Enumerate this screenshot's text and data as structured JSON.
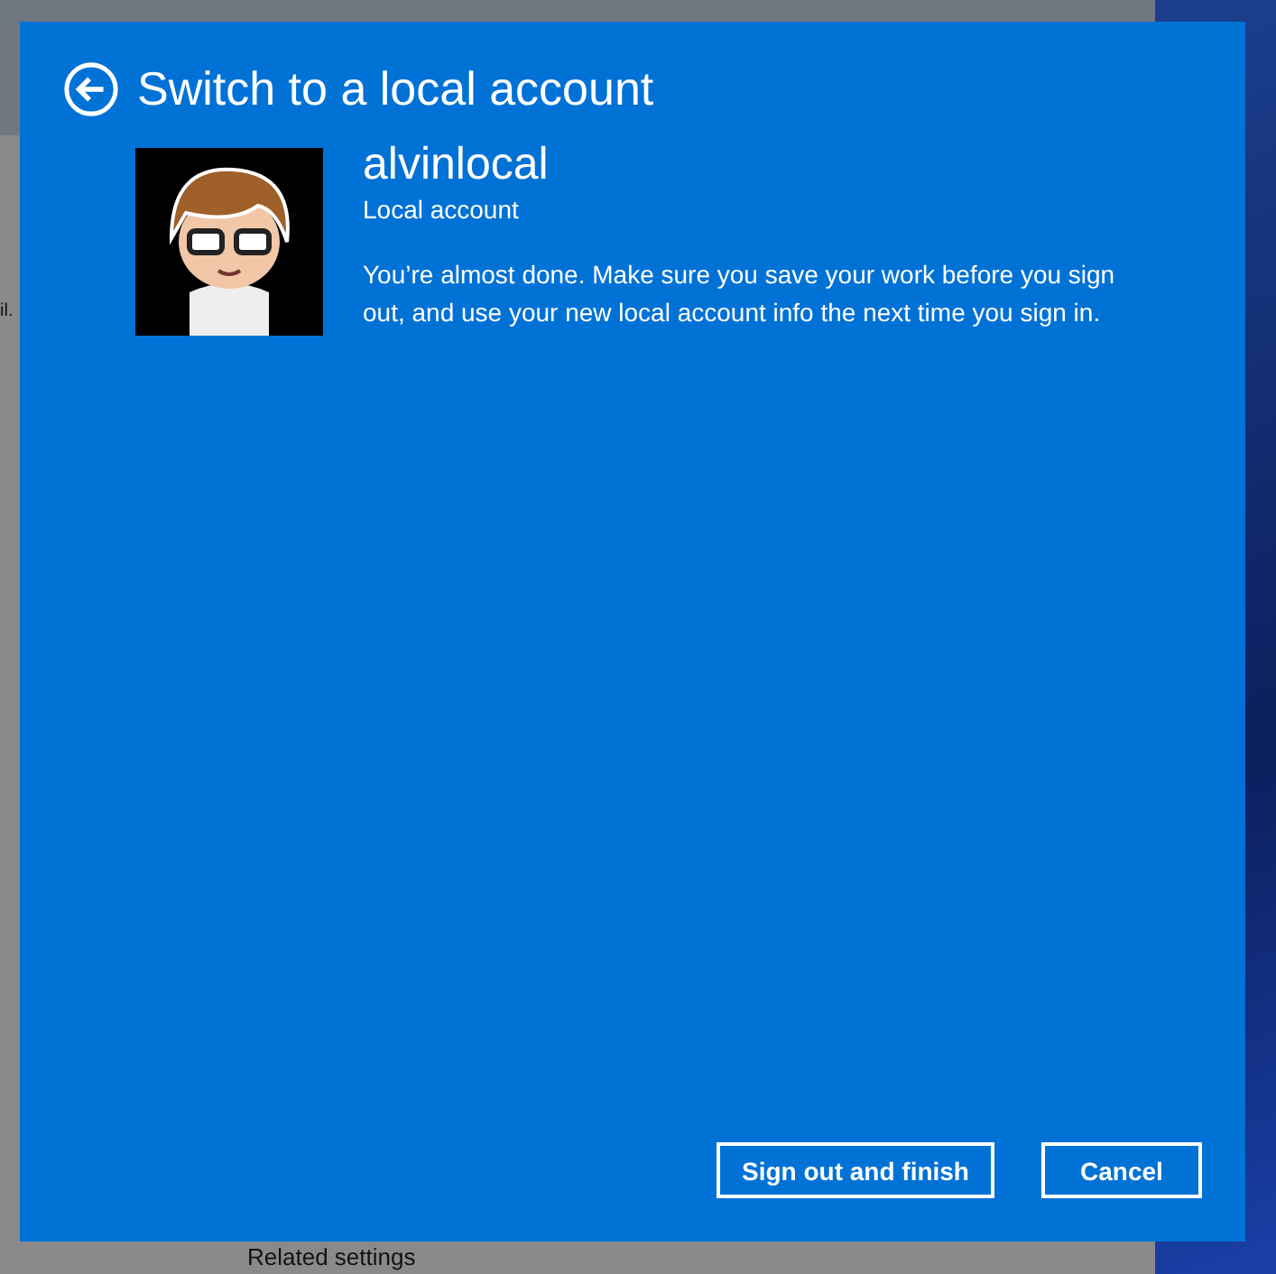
{
  "background_window": {
    "cut_text": "il.",
    "section_heading": "Related settings"
  },
  "dialog": {
    "title": "Switch to a local account",
    "account": {
      "name": "alvinlocal",
      "type": "Local account"
    },
    "message": "You’re almost done. Make sure you save your work before you sign out, and use your new local account info the next time you sign in.",
    "buttons": [
      {
        "label": "Sign out and finish",
        "kind": "primary"
      },
      {
        "label": "Cancel",
        "kind": "secondary"
      }
    ]
  }
}
